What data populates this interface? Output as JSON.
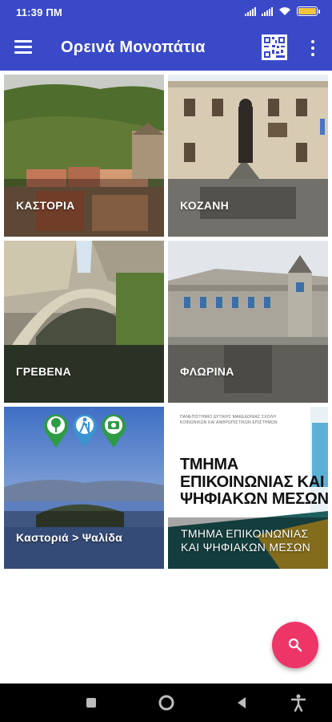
{
  "status_bar": {
    "time": "11:39 ΠΜ",
    "icons": [
      "signal-icon",
      "signal-icon",
      "wifi-icon",
      "battery-icon"
    ],
    "battery_color": "#f2c43a"
  },
  "app_bar": {
    "title": "Ορεινά Μονοπάτια",
    "color": "#3949c8",
    "icons": [
      "menu-icon",
      "qr-code-icon",
      "more-vert-icon"
    ]
  },
  "tiles": [
    {
      "label": "ΚΑΣΤΟΡΙΑ"
    },
    {
      "label": "ΚΟΖΑΝΗ"
    },
    {
      "label": "ΓΡΕΒΕΝΑ"
    },
    {
      "label": "ΦΛΩΡΙΝΑ"
    },
    {
      "label": "Καστοριά > Ψαλίδα",
      "icons": [
        "tree-pin-icon",
        "hiker-pin-icon",
        "camera-pin-icon"
      ],
      "pin_color": "#2e9b45"
    },
    {
      "label": "ΤΜΗΜΑ ΕΠΙΚΟΙΝΩΝΙΑΣ ΚΑΙ ΨΗΦΙΑΚΩΝ ΜΕΣΩΝ",
      "banner_small": "ΠΑΝΕΠΙΣΤΗΜΙΟ ΔΥΤΙΚΗΣ ΜΑΚΕΔΟΝΙΑΣ ΣΧΟΛΗ ΚΟΙΝΩΝΙΚΩΝ ΚΑΙ ΑΝΘΡΩΠΙΣΤΙΚΩΝ ΕΠΙΣΤΗΜΩΝ",
      "banner_title": "ΤΜΗΜΑ ΕΠΙΚΟΙΝΩΝΙΑΣ ΚΑΙ ΨΗΦΙΑΚΩΝ ΜΕΣΩΝ"
    }
  ],
  "fab": {
    "icon": "search-icon",
    "color": "#ee3567"
  },
  "nav_bar": {
    "icons": [
      "recents-square-icon",
      "home-circle-icon",
      "back-triangle-icon",
      "accessibility-icon"
    ]
  }
}
